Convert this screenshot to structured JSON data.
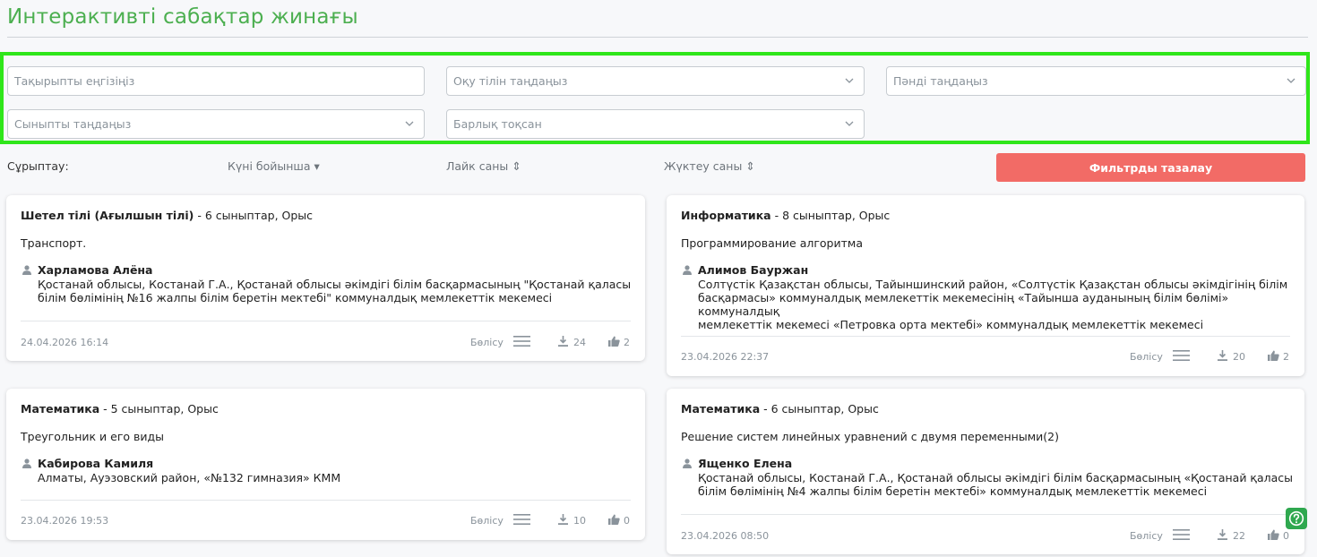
{
  "page": {
    "title": "Интерактивті сабақтар жинағы"
  },
  "filters": {
    "topic_placeholder": "Тақырыпты еңгізіңіз",
    "language_placeholder": "Оқу тілін таңдаңыз",
    "subject_placeholder": "Пәнді таңдаңыз",
    "grade_placeholder": "Сыныпты таңдаңыз",
    "quarter_value": "Барлық тоқсан"
  },
  "sort": {
    "label": "Сұрыптау:",
    "by_date": "Күні бойынша ▾",
    "by_likes": "Лайк саны ⇕",
    "by_downloads": "Жүктеу саны ⇕",
    "clear_button": "Фильтрды тазалау"
  },
  "colors": {
    "accent": "#4caf50",
    "highlight": "#2fe61a",
    "clear_button": "#f26b66",
    "help": "#2fa84f"
  },
  "cards": [
    {
      "subject": "Шетел тілі (Ағылшын тілі)",
      "meta": " - 6 сыныптар, Орыс",
      "topic": "Транспорт.",
      "author": "Харламова Алёна",
      "org_lines": [
        "Қостанай облысы, Костанай Г.А., Қостанай облысы әкімдігі білім басқармасының \"Қостанай қаласы",
        "білім бөлімінің №16 жалпы білім беретін мектебі\" коммуналдық мемлекеттік мекемесі"
      ],
      "date": "24.04.2026 16:14",
      "share": "Бөлісу",
      "downloads": "24",
      "likes": "2"
    },
    {
      "subject": "Информатика",
      "meta": " - 8 сыныптар, Орыс",
      "topic": "Программирование алгоритма",
      "author": "Алимов Бауржан",
      "org_lines": [
        "Солтүстік Қазақстан облысы, Тайыншинский район, «Солтүстік Қазақстан облысы әкімдігінің білім",
        "басқармасы» коммуналдық мемлекеттік мекемесінің «Тайынша ауданының білім бөлімі» коммуналдық",
        "мемлекеттік мекемесі «Петровка орта мектебі» коммуналдық мемлекеттік мекемесі"
      ],
      "date": "23.04.2026 22:37",
      "share": "Бөлісу",
      "downloads": "20",
      "likes": "2"
    },
    {
      "subject": "Математика",
      "meta": " - 5 сыныптар, Орыс",
      "topic": "Треугольник и его виды",
      "author": "Кабирова Камиля",
      "org_lines": [
        "Алматы, Ауэзовский район, «№132 гимназия» КММ"
      ],
      "date": "23.04.2026 19:53",
      "share": "Бөлісу",
      "downloads": "10",
      "likes": "0"
    },
    {
      "subject": "Математика",
      "meta": " - 6 сыныптар, Орыс",
      "topic": "Решение систем линейных уравнений с двумя переменными(2)",
      "author": "Ященко Елена",
      "org_lines": [
        "Қостанай облысы, Костанай Г.А., Қостанай облысы әкімдігі білім басқармасының «Қостанай қаласы",
        "білім бөлімінің №4 жалпы білім беретін мектебі» коммуналдық мемлекеттік мекемесі"
      ],
      "date": "23.04.2026 08:50",
      "share": "Бөлісу",
      "downloads": "22",
      "likes": "0"
    }
  ]
}
